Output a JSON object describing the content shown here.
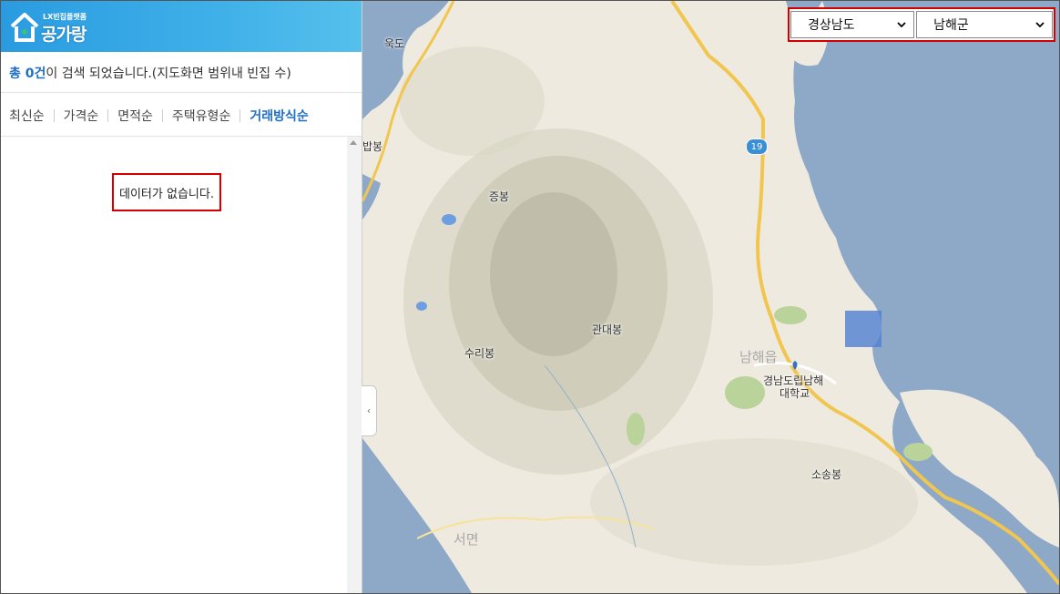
{
  "app": {
    "logo_small": "LX빈집플랫폼",
    "logo_brand": "공가랑"
  },
  "result": {
    "prefix": "총 ",
    "count": "0건",
    "suffix": "이 검색 되었습니다.(지도화면 범위내 빈집 수)"
  },
  "sort": {
    "items": [
      "최신순",
      "가격순",
      "면적순",
      "주택유형순",
      "거래방식순"
    ],
    "active_index": 4
  },
  "list": {
    "empty_message": "데이터가 없습니다."
  },
  "filters": {
    "province": "경상남도",
    "county": "남해군"
  },
  "map": {
    "labels": {
      "p1": "욱도",
      "p2": "밥봉",
      "p3": "증봉",
      "p4": "관대봉",
      "p5": "수리봉",
      "p6": "남해읍",
      "p7": "경남도립남해",
      "p8": "대학교",
      "p9": "소송봉",
      "p10": "서면"
    },
    "route": "19"
  },
  "colors": {
    "accent": "#1f6fc5",
    "highlight_border": "#d40000",
    "sea": "#8ea8c8",
    "land": "#efeadf"
  },
  "icons": {
    "collapse": "chevron-left-icon",
    "scroll_up": "arrow-up-icon",
    "dropdown": "chevron-down-icon"
  }
}
